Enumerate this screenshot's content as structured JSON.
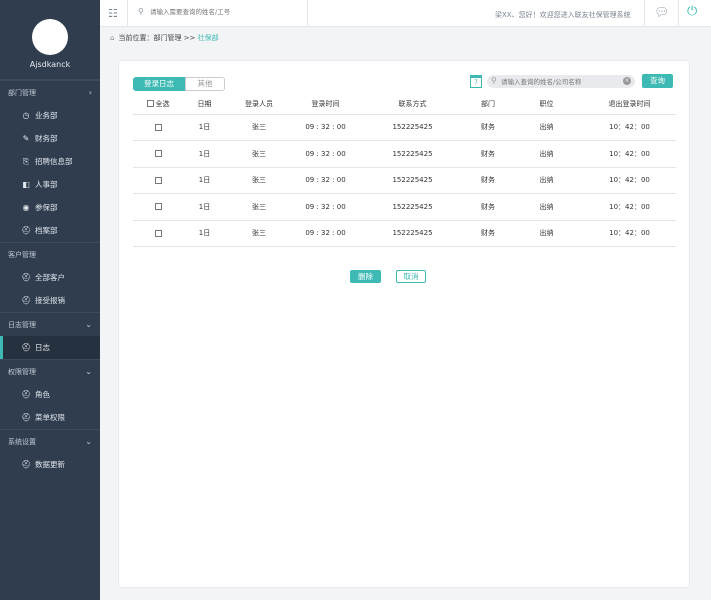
{
  "sidebar": {
    "username": "Ajsdkanck",
    "sections": [
      {
        "title": "部门管理",
        "chevron": "›",
        "items": [
          {
            "label": "业务部",
            "icon": "◷"
          },
          {
            "label": "财务部",
            "icon": "✎"
          },
          {
            "label": "招聘信息部",
            "icon": "⎘"
          },
          {
            "label": "人事部",
            "icon": "◧"
          },
          {
            "label": "参保部",
            "icon": "◉"
          },
          {
            "label": "档案部",
            "icon": "⛑"
          }
        ]
      },
      {
        "title": "客户管理",
        "items": [
          {
            "label": "全部客户",
            "icon": "⛑"
          },
          {
            "label": "接受报销",
            "icon": "⛑"
          }
        ]
      },
      {
        "title": "日志管理",
        "chevron": "⌄",
        "items": [
          {
            "label": "日志",
            "icon": "⛑"
          }
        ]
      },
      {
        "title": "权限管理",
        "chevron": "⌄",
        "items": [
          {
            "label": "角色",
            "icon": "⛑"
          },
          {
            "label": "菜单权限",
            "icon": "⛑"
          }
        ]
      },
      {
        "title": "系统设置",
        "chevron": "⌄",
        "items": [
          {
            "label": "数据更新",
            "icon": "⛑"
          }
        ]
      }
    ]
  },
  "topbar": {
    "search_placeholder": "请输入需要查询的姓名/工号",
    "welcome": "梁XX、您好！欢迎您进入联友社保管理系统"
  },
  "breadcrumb": {
    "prefix": "当前位置：",
    "path": "部门管理 >> ",
    "current": "社保部"
  },
  "panel": {
    "tabs": [
      "登录日志",
      "其他"
    ],
    "search_placeholder": "请输入查询的姓名/公司名称",
    "query_label": "查询",
    "table": {
      "headers": [
        "全选",
        "日期",
        "登录人员",
        "登录时间",
        "联系方式",
        "部门",
        "职位",
        "退出登录时间"
      ],
      "rows": [
        [
          "1日",
          "张三",
          "09 : 32 : 00",
          "152225425",
          "财务",
          "出纳",
          "10：42：00"
        ],
        [
          "1日",
          "张三",
          "09 : 32 : 00",
          "152225425",
          "财务",
          "出纳",
          "10：42：00"
        ],
        [
          "1日",
          "张三",
          "09 : 32 : 00",
          "152225425",
          "财务",
          "出纳",
          "10：42：00"
        ],
        [
          "1日",
          "张三",
          "09 : 32 : 00",
          "152225425",
          "财务",
          "出纳",
          "10：42：00"
        ],
        [
          "1日",
          "张三",
          "09 : 32 : 00",
          "152225425",
          "财务",
          "出纳",
          "10：42：00"
        ]
      ]
    },
    "delete_label": "删除",
    "cancel_label": "取消"
  },
  "colors": {
    "accent": "#3dbab3",
    "sidebar_bg": "#2f3d4f"
  }
}
